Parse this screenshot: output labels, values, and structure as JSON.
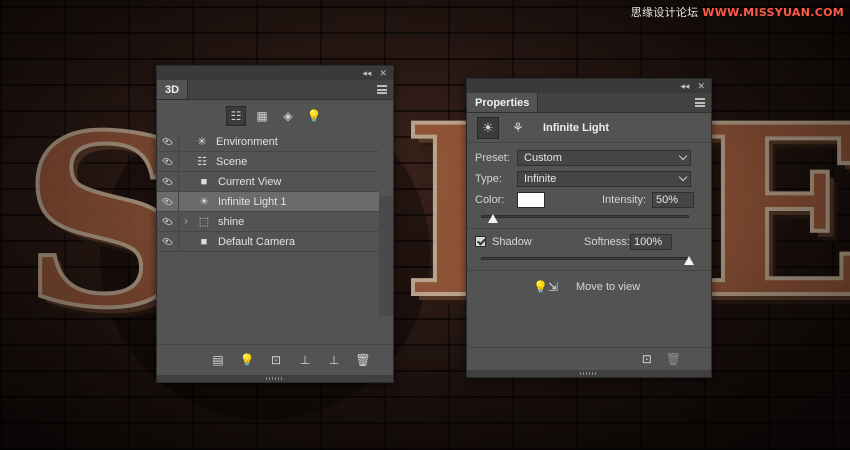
{
  "background": {
    "letters": [
      "S",
      "I",
      "E"
    ],
    "watermark": {
      "prefix": "思缘设计论坛 ",
      "brand": "WWW.MISSYUAN.COM"
    }
  },
  "panel_3d": {
    "tab": "3D",
    "collapse_label": "◂◂",
    "close_label": "✕",
    "toolbar": [
      {
        "name": "whole-scene-filter",
        "icon": "scene-tree-icon",
        "glyph": "☷",
        "active": true
      },
      {
        "name": "meshes-filter",
        "icon": "mesh-icon",
        "glyph": "▦",
        "active": false
      },
      {
        "name": "materials-filter",
        "icon": "material-icon",
        "glyph": "◈",
        "active": false
      },
      {
        "name": "lights-filter",
        "icon": "light-bulb-icon",
        "glyph": "💡",
        "active": false
      }
    ],
    "layers": [
      {
        "label": "Environment",
        "icon": "environment-icon",
        "glyph": "✳",
        "indent": 0,
        "expander": "",
        "selected": false
      },
      {
        "label": "Scene",
        "icon": "scene-icon",
        "glyph": "☷",
        "indent": 0,
        "expander": "",
        "selected": false
      },
      {
        "label": "Current View",
        "icon": "camera-icon",
        "glyph": "■",
        "indent": 1,
        "expander": "",
        "selected": false
      },
      {
        "label": "Infinite Light 1",
        "icon": "infinite-light-icon",
        "glyph": "☀",
        "indent": 1,
        "expander": "",
        "selected": true
      },
      {
        "label": "shine",
        "icon": "mesh-object-icon",
        "glyph": "⬚",
        "indent": 1,
        "expander": "›",
        "selected": false
      },
      {
        "label": "Default Camera",
        "icon": "camera-icon",
        "glyph": "■",
        "indent": 1,
        "expander": "",
        "selected": false
      }
    ],
    "bottom_tools": [
      {
        "name": "render-button",
        "icon": "render-icon",
        "glyph": "▤"
      },
      {
        "name": "add-light-button",
        "icon": "add-light-icon",
        "glyph": "💡"
      },
      {
        "name": "add-constraint-button",
        "icon": "constraint-icon",
        "glyph": "⊡"
      },
      {
        "name": "drop-to-ground-button",
        "icon": "drop-to-ground-icon",
        "glyph": "⊥"
      },
      {
        "name": "split-button",
        "icon": "split-icon",
        "glyph": "⊥"
      },
      {
        "name": "delete-button",
        "icon": "trash-icon",
        "glyph": "🗑"
      }
    ]
  },
  "properties": {
    "tab": "Properties",
    "collapse_label": "◂◂",
    "close_label": "✕",
    "title": "Infinite Light",
    "preset": {
      "label": "Preset:",
      "value": "Custom"
    },
    "type": {
      "label": "Type:",
      "value": "Infinite"
    },
    "color": {
      "label": "Color:",
      "hex": "#ffffff"
    },
    "intensity": {
      "label": "Intensity:",
      "value": "50%",
      "fraction": 0.06
    },
    "shadow": {
      "label": "Shadow",
      "checked": true
    },
    "softness": {
      "label": "Softness:",
      "value": "100%",
      "fraction": 1.0
    },
    "move_to_view": "Move to view"
  }
}
